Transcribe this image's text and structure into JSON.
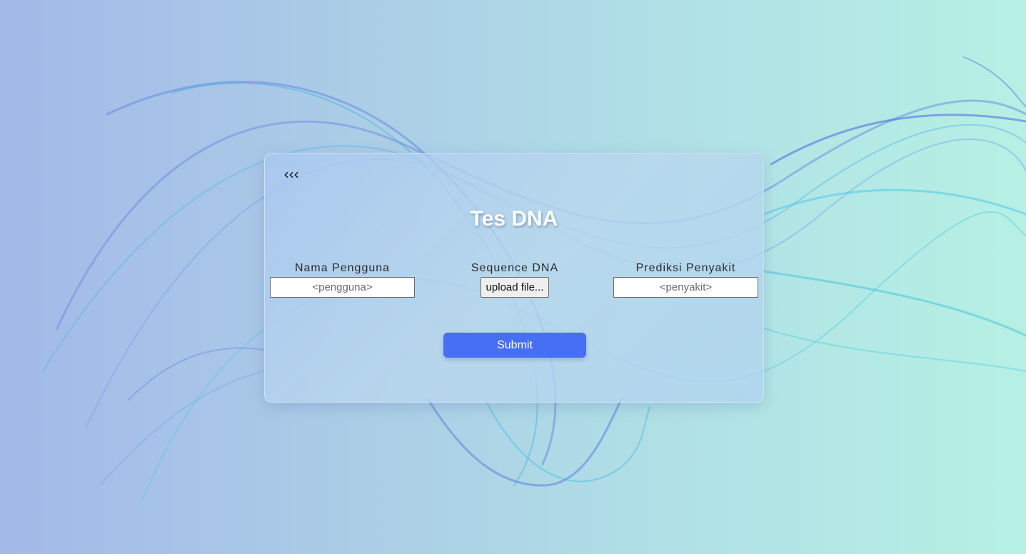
{
  "back": {
    "label": "‹‹‹"
  },
  "page": {
    "title": "Tes DNA"
  },
  "form": {
    "username": {
      "label": "Nama Pengguna",
      "placeholder": "<pengguna>",
      "value": ""
    },
    "sequence": {
      "label": "Sequence DNA",
      "button_label": "upload file..."
    },
    "prediction": {
      "label": "Prediksi Penyakit",
      "placeholder": "<penyakit>",
      "value": ""
    },
    "submit_label": "Submit"
  },
  "colors": {
    "accent": "#466ff4",
    "background_left": "#a3b9e9",
    "background_right": "#b6f0e4"
  }
}
